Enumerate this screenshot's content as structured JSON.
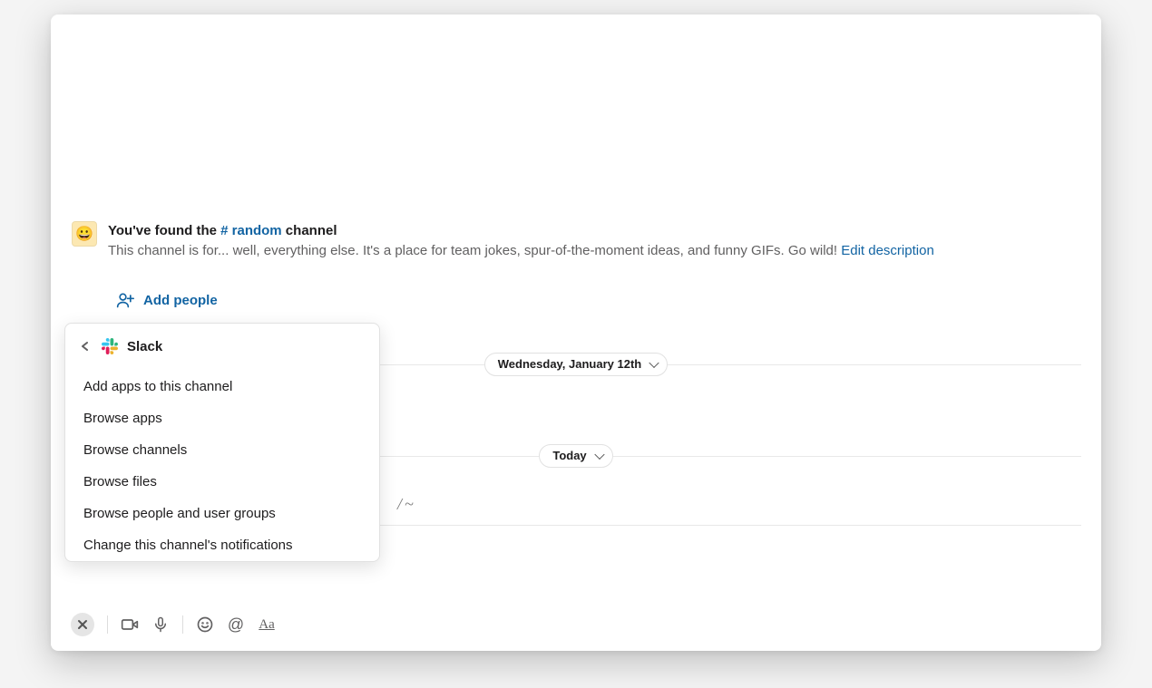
{
  "intro": {
    "title_prefix": "You've found the ",
    "channel_hash": "# random",
    "title_suffix": " channel",
    "description": "This channel is for... well, everything else. It's a place for team jokes, spur-of-the-moment ideas, and funny GIFs. Go wild! ",
    "edit_link": "Edit description",
    "emoji": "😀"
  },
  "add_people_label": "Add people",
  "date_dividers": {
    "first": "Wednesday, January 12th",
    "second": "Today"
  },
  "ghost_placeholder": "/~",
  "popover": {
    "title": "Slack",
    "items": [
      "Add apps to this channel",
      "Browse apps",
      "Browse channels",
      "Browse files",
      "Browse people and user groups",
      "Change this channel's notifications"
    ]
  },
  "composer_at": "@",
  "composer_aa": "Aa"
}
